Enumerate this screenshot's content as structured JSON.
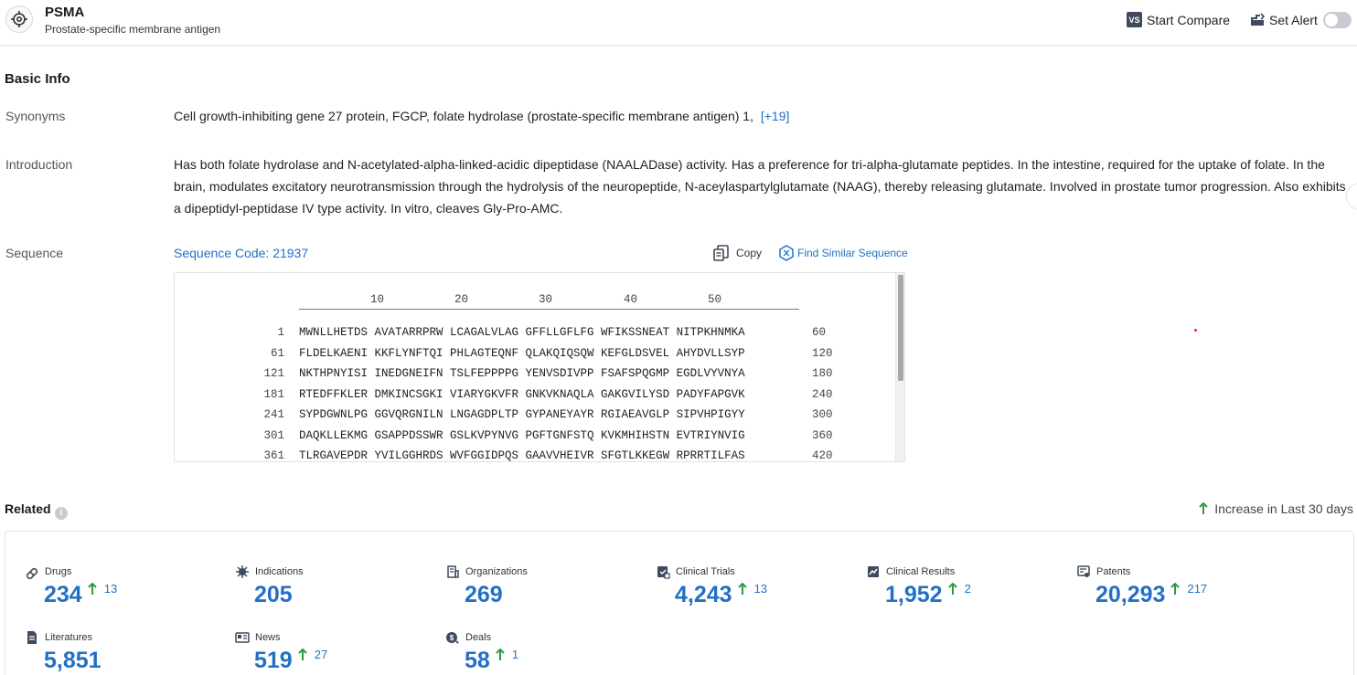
{
  "header": {
    "title": "PSMA",
    "subtitle": "Prostate-specific membrane antigen",
    "compare_badge": "VS",
    "compare_label": "Start Compare",
    "alert_label": "Set Alert"
  },
  "basic_info": {
    "title": "Basic Info",
    "synonyms_label": "Synonyms",
    "synonyms_text": "Cell growth-inhibiting gene 27 protein,  FGCP,  folate hydrolase (prostate-specific membrane antigen) 1,",
    "synonyms_more": "[+19]",
    "introduction_label": "Introduction",
    "introduction_lines": [
      "Has both folate hydrolase and N-acetylated-alpha-linked-acidic dipeptidase (NAALADase) activity. Has a preference for tri-alpha-glutamate peptides. In the intestine, required for the uptake of folate. In the",
      "brain, modulates excitatory neurotransmission through the hydrolysis of the neuropeptide, N-aceylaspartylglutamate (NAAG), thereby releasing glutamate. Involved in prostate tumor progression. Also exhibits",
      "a dipeptidyl-peptidase IV type activity. In vitro, cleaves Gly-Pro-AMC."
    ],
    "sequence_label": "Sequence",
    "sequence_code": "Sequence Code: 21937",
    "copy_label": "Copy",
    "find_similar_label": "Find Similar Sequence"
  },
  "sequence": {
    "ruler": [
      "10",
      "20",
      "30",
      "40",
      "50"
    ],
    "lines": [
      {
        "start": "1",
        "residues": "MWNLLHETDS AVATARRPRW LCAGALVLAG GFFLLGFLFG WFIKSSNEAT NITPKHNMKA",
        "end": "60"
      },
      {
        "start": "61",
        "residues": "FLDELKAENI KKFLYNFTQI PHLAGTEQNF QLAKQIQSQW KEFGLDSVEL AHYDVLLSYP",
        "end": "120"
      },
      {
        "start": "121",
        "residues": "NKTHPNYISI INEDGNEIFN TSLFEPPPPG YENVSDIVPP FSAFSPQGMP EGDLVYVNYA",
        "end": "180"
      },
      {
        "start": "181",
        "residues": "RTEDFFKLER DMKINCSGKI VIARYGKVFR GNKVKNAQLA GAKGVILYSD PADYFAPGVK",
        "end": "240"
      },
      {
        "start": "241",
        "residues": "SYPDGWNLPG GGVQRGNILN LNGAGDPLTP GYPANEYAYR RGIAEAVGLP SIPVHPIGYY",
        "end": "300"
      },
      {
        "start": "301",
        "residues": "DAQKLLEKMG GSAPPDSSWR GSLKVPYNVG PGFTGNFSTQ KVKMHIHSTN EVTRIYNVIG",
        "end": "360"
      },
      {
        "start": "361",
        "residues": "TLRGAVEPDR YVILGGHRDS WVFGGIDPQS GAAVVHEIVR SFGTLKKEGW RPRRTILFAS",
        "end": "420"
      }
    ]
  },
  "related": {
    "title": "Related",
    "increase_label": "Increase in Last 30 days",
    "stats": [
      {
        "label": "Drugs",
        "value": "234",
        "increase": "13",
        "icon": "pill-icon"
      },
      {
        "label": "Indications",
        "value": "205",
        "increase": "",
        "icon": "virus-icon"
      },
      {
        "label": "Organizations",
        "value": "269",
        "increase": "",
        "icon": "building-icon"
      },
      {
        "label": "Clinical Trials",
        "value": "4,243",
        "increase": "13",
        "icon": "clipboard-icon"
      },
      {
        "label": "Clinical Results",
        "value": "1,952",
        "increase": "2",
        "icon": "report-icon"
      },
      {
        "label": "Patents",
        "value": "20,293",
        "increase": "217",
        "icon": "patent-icon"
      },
      {
        "label": "Literatures",
        "value": "5,851",
        "increase": "",
        "icon": "document-icon"
      },
      {
        "label": "News",
        "value": "519",
        "increase": "27",
        "icon": "newspaper-icon"
      },
      {
        "label": "Deals",
        "value": "58",
        "increase": "1",
        "icon": "deal-icon"
      }
    ]
  },
  "colors": {
    "accent": "#2270c6",
    "increase_arrow": "#2e9b3a"
  }
}
